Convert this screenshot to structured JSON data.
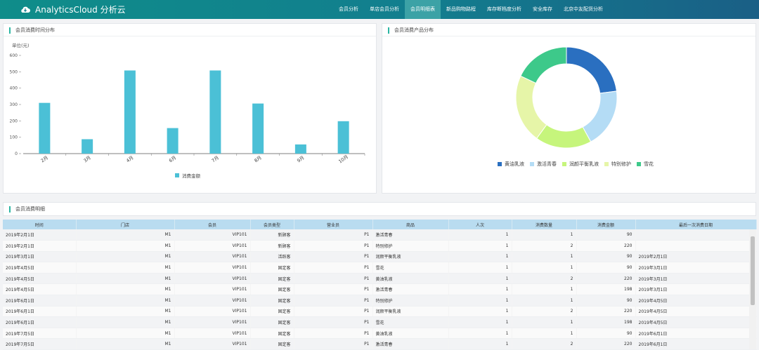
{
  "brand": {
    "name": "AnalyticsCloud 分析云"
  },
  "nav": {
    "items": [
      {
        "label": "会员分析"
      },
      {
        "label": "单店会员分析"
      },
      {
        "label": "会员明细表"
      },
      {
        "label": "新品购物路程"
      },
      {
        "label": "库存断档度分析"
      },
      {
        "label": "安全库存"
      },
      {
        "label": "北京中友配货分析"
      }
    ],
    "active_index": 2
  },
  "colors": {
    "accent": "#2bb6a3",
    "bar": "#4bc0d6",
    "header": "#b9dcf0"
  },
  "bar_panel": {
    "title": "会员消费时间分布"
  },
  "donut_panel": {
    "title": "会员消费产品分布"
  },
  "table_panel": {
    "title": "会员消费明细"
  },
  "chart_data": [
    {
      "type": "bar",
      "categories": [
        "2月",
        "3月",
        "4月",
        "6月",
        "7月",
        "8月",
        "9月",
        "10月"
      ],
      "values": [
        310,
        88,
        508,
        156,
        508,
        306,
        56,
        198
      ],
      "ylabel": "单位(元)",
      "yticks": [
        "0",
        "100",
        "200",
        "300",
        "400",
        "500",
        "600"
      ],
      "ylim": [
        0,
        600
      ],
      "series": [
        {
          "name": "消费金额",
          "values": [
            310,
            88,
            508,
            156,
            508,
            306,
            56,
            198
          ]
        }
      ],
      "legend": "bottom",
      "grid": false
    },
    {
      "type": "pie",
      "categories": [
        "黄油乳液",
        "激活青春",
        "润颜平衡乳液",
        "特别修护",
        "雪花"
      ],
      "values": [
        23,
        19,
        18,
        22,
        18
      ],
      "colors": [
        "#2a6fc0",
        "#b4dcf5",
        "#c6f57c",
        "#e6f5a8",
        "#3dc98a"
      ],
      "legend": "bottom"
    }
  ],
  "table": {
    "columns": [
      "时间",
      "门店",
      "会员",
      "会员类型",
      "营业员",
      "商品",
      "人次",
      "消费数量",
      "消费金额",
      "最后一次消费日期"
    ],
    "rows": [
      [
        "2019年2月1日",
        "M1",
        "VIP101",
        "新顾客",
        "P1",
        "激活青春",
        "1",
        "1",
        "90",
        ""
      ],
      [
        "2019年2月1日",
        "M1",
        "VIP101",
        "新顾客",
        "P1",
        "特别修护",
        "1",
        "2",
        "220",
        ""
      ],
      [
        "2019年3月1日",
        "M1",
        "VIP101",
        "活跃客",
        "P1",
        "润颜平衡乳液",
        "1",
        "1",
        "90",
        "2019年2月1日"
      ],
      [
        "2019年4月5日",
        "M1",
        "VIP101",
        "固定客",
        "P1",
        "雪花",
        "1",
        "1",
        "90",
        "2019年3月1日"
      ],
      [
        "2019年4月5日",
        "M1",
        "VIP101",
        "固定客",
        "P1",
        "黄油乳液",
        "1",
        "2",
        "220",
        "2019年3月1日"
      ],
      [
        "2019年4月5日",
        "M1",
        "VIP101",
        "固定客",
        "P1",
        "激活青春",
        "1",
        "1",
        "198",
        "2019年3月1日"
      ],
      [
        "2019年6月1日",
        "M1",
        "VIP101",
        "固定客",
        "P1",
        "特别修护",
        "1",
        "1",
        "90",
        "2019年4月5日"
      ],
      [
        "2019年6月1日",
        "M1",
        "VIP101",
        "固定客",
        "P1",
        "润颜平衡乳液",
        "1",
        "2",
        "220",
        "2019年4月5日"
      ],
      [
        "2019年6月1日",
        "M1",
        "VIP101",
        "固定客",
        "P1",
        "雪花",
        "1",
        "1",
        "198",
        "2019年4月5日"
      ],
      [
        "2019年7月5日",
        "M1",
        "VIP101",
        "固定客",
        "P1",
        "黄油乳液",
        "1",
        "1",
        "90",
        "2019年6月1日"
      ],
      [
        "2019年7月5日",
        "M1",
        "VIP101",
        "固定客",
        "P1",
        "激活青春",
        "1",
        "2",
        "220",
        "2019年6月1日"
      ]
    ]
  }
}
